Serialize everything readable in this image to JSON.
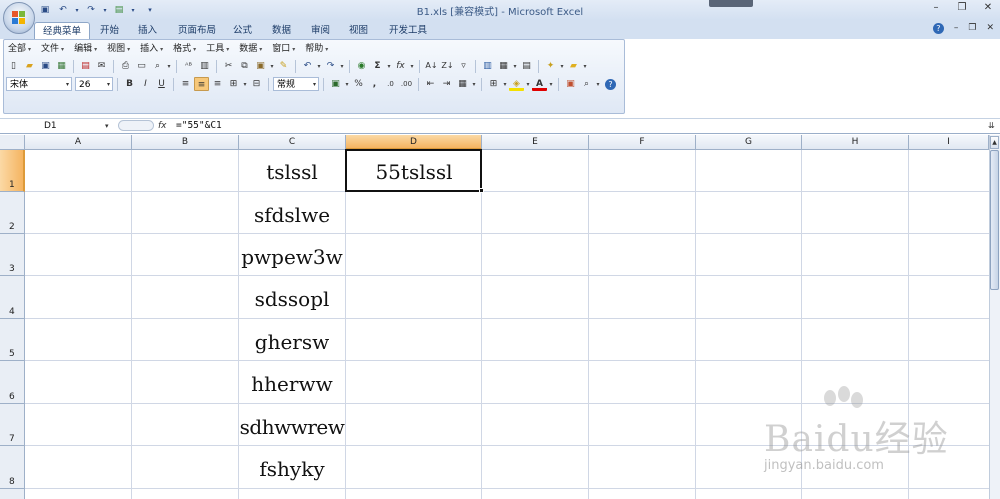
{
  "window": {
    "title": "B1.xls  [兼容模式] - Microsoft Excel",
    "minimize": "–",
    "restore": "❐",
    "close": "✕"
  },
  "tabs": [
    "经典菜单",
    "开始",
    "插入",
    "页面布局",
    "公式",
    "数据",
    "审阅",
    "视图",
    "开发工具"
  ],
  "active_tab": "经典菜单",
  "menu": [
    "全部",
    "文件",
    "编辑",
    "视图",
    "插入",
    "格式",
    "工具",
    "数据",
    "窗口",
    "帮助"
  ],
  "toolbar": {
    "font_name": "宋体",
    "font_size": "26",
    "bold": "B",
    "italic": "I",
    "underline": "U",
    "number_format": "常规",
    "percent": "%",
    "comma": ","
  },
  "formula_bar": {
    "name_box": "D1",
    "fx": "fx",
    "formula": "=\"55\"&C1"
  },
  "columns": [
    "A",
    "B",
    "C",
    "D",
    "E",
    "F",
    "G",
    "H",
    "I"
  ],
  "selected_column": "D",
  "rows": [
    "1",
    "2",
    "3",
    "4",
    "5",
    "6",
    "7",
    "8"
  ],
  "selected_row": "1",
  "cells": {
    "C1": "tslssl",
    "C2": "sfdslwe",
    "C3": "pwpew3w",
    "C4": "sdssopl",
    "C5": "ghersw",
    "C6": "hherww",
    "C7": "sdhwwrew",
    "C8": "fshyky",
    "D1": "55tslssl"
  },
  "active_cell": "D1",
  "watermark": {
    "brand": "Baidu经验",
    "url": "jingyan.baidu.com"
  }
}
